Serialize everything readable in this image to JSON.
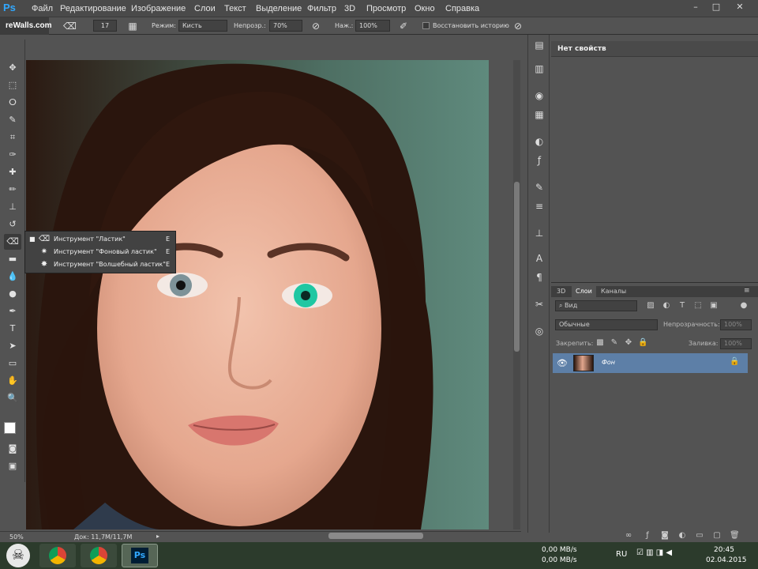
{
  "app": {
    "logo": "Ps",
    "site_badge": "reWalls.com"
  },
  "menubar": {
    "items": [
      "Файл",
      "Редактирование",
      "Изображение",
      "Слои",
      "Текст",
      "Выделение",
      "Фильтр",
      "3D",
      "Просмотр",
      "Окно",
      "Справка"
    ],
    "window_controls": [
      "–",
      "□",
      "✕"
    ]
  },
  "options_bar": {
    "brush_size": "17",
    "mode_label": "Режим:",
    "mode_value": "Кисть",
    "opacity_label": "Непрозр.:",
    "opacity_value": "70%",
    "pressure_label": "Наж.:",
    "pressure_value": "100%",
    "restore_history_label": "Восстановить историю",
    "restore_history_checked": false
  },
  "tool_flyout": {
    "items": [
      {
        "label": "Инструмент \"Ластик\"",
        "key": "E",
        "active": true
      },
      {
        "label": "Инструмент \"Фоновый ластик\"",
        "key": "E",
        "active": false
      },
      {
        "label": "Инструмент \"Волшебный ластик\"",
        "key": "E",
        "active": false
      }
    ]
  },
  "status_bar": {
    "zoom": "50%",
    "doc_info": "Док: 11,7M/11,7M"
  },
  "properties": {
    "header": "Нет свойств"
  },
  "layers_panel": {
    "tabs": [
      "3D",
      "Слои",
      "Каналы"
    ],
    "active_tab": "Слои",
    "filter_label": "Вид",
    "blend_mode": "Обычные",
    "opacity_label": "Непрозрачность:",
    "opacity_value": "100%",
    "lock_label": "Закрепить:",
    "fill_label": "Заливка:",
    "fill_value": "100%",
    "layers": [
      {
        "name": "Фон",
        "visible": true,
        "locked": true,
        "selected": true
      }
    ]
  },
  "taskbar": {
    "network_up": "0,00 MB/s",
    "network_down": "0,00 MB/s",
    "language": "RU",
    "time": "20:45",
    "date": "02.04.2015"
  },
  "colors": {
    "accent": "#31a8ff",
    "layer_selected": "#5d7fa7",
    "eye_recolored": "#1fc7a2"
  }
}
